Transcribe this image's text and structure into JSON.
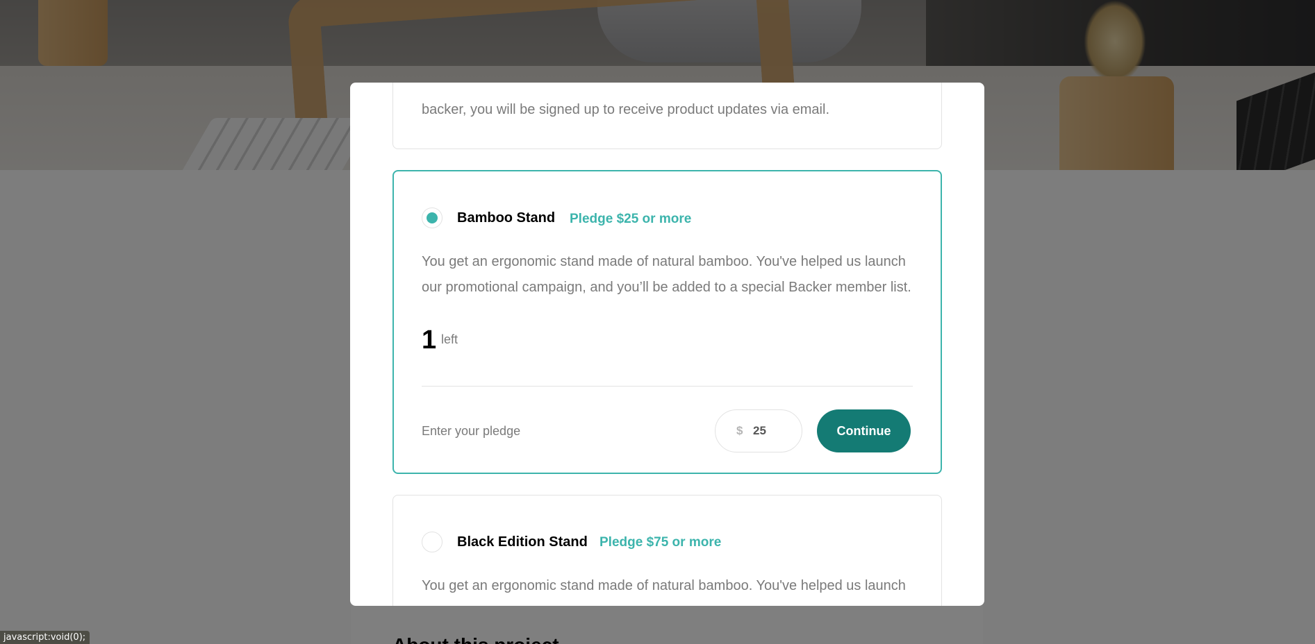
{
  "page": {
    "about_heading": "About this project"
  },
  "modal": {
    "top_reward": {
      "description_fragment": "backer, you will be signed up to receive product updates via email."
    },
    "rewards": [
      {
        "name": "Bamboo Stand",
        "pledge_min": "Pledge $25 or more",
        "description": "You get an ergonomic stand made of natural bamboo. You've helped us launch our promotional campaign, and you’ll be added to a special Backer member list.",
        "left_count": "1",
        "left_label": "left",
        "selected": true,
        "enter_label": "Enter your pledge",
        "currency": "$",
        "amount": "25",
        "continue_label": "Continue"
      },
      {
        "name": "Black Edition Stand",
        "pledge_min": "Pledge $75 or more",
        "description": "You get an ergonomic stand made of natural bamboo. You've helped us launch",
        "selected": false
      }
    ]
  },
  "statusbar": {
    "text": "javascript:void(0);"
  },
  "colors": {
    "accent": "#3cb4ac",
    "button": "#147b74",
    "text_muted": "#7a7a7a"
  }
}
